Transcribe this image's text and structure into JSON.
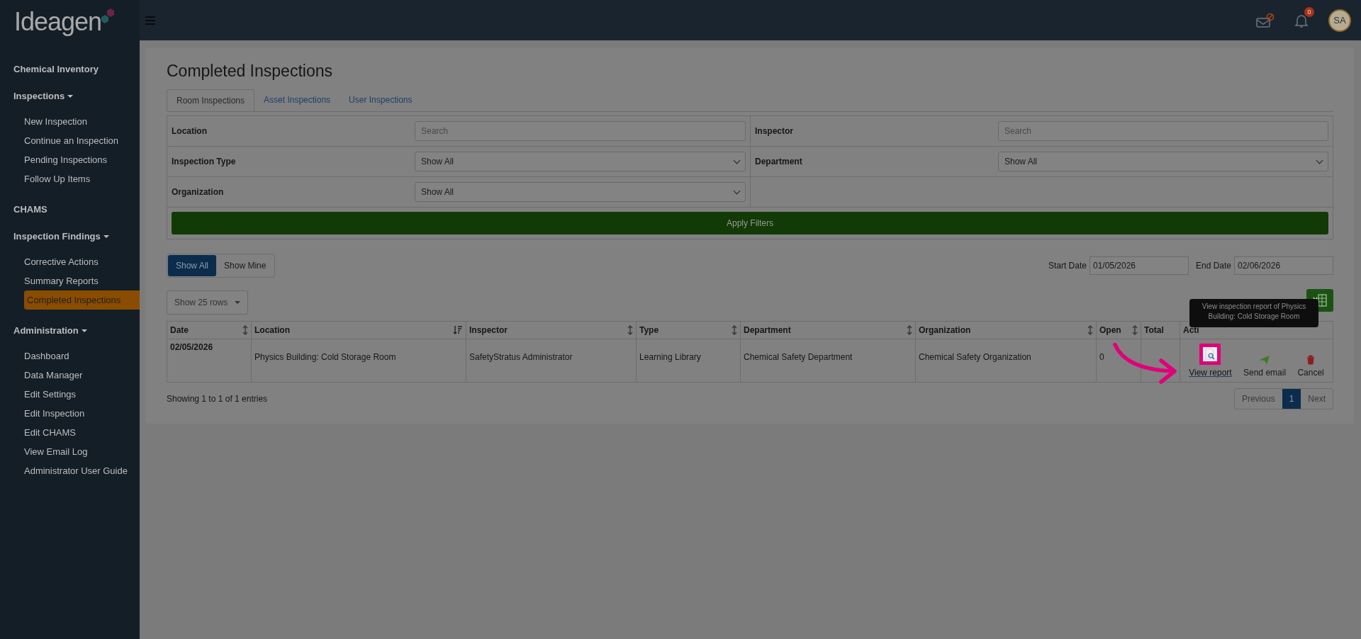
{
  "logo": {
    "text": "Ideagen"
  },
  "header": {
    "notification_count": "0",
    "avatar": "SA"
  },
  "sidebar": {
    "items": [
      {
        "label": "Chemical Inventory"
      },
      {
        "label": "Inspections",
        "expanded": true,
        "children": [
          {
            "label": "New Inspection",
            "selected": false
          },
          {
            "label": "Continue an Inspection",
            "selected": false
          },
          {
            "label": "Pending Inspections",
            "selected": false
          },
          {
            "label": "Follow Up Items",
            "selected": false
          }
        ]
      },
      {
        "label": "CHAMS"
      },
      {
        "label": "Inspection Findings",
        "expanded": true,
        "children": [
          {
            "label": "Corrective Actions",
            "selected": false
          },
          {
            "label": "Summary Reports",
            "selected": false
          },
          {
            "label": "Completed Inspections",
            "selected": true
          }
        ]
      },
      {
        "label": "Administration",
        "expanded": true,
        "children": [
          {
            "label": "Dashboard",
            "selected": false
          },
          {
            "label": "Data Manager",
            "selected": false
          },
          {
            "label": "Edit Settings",
            "selected": false
          },
          {
            "label": "Edit Inspection",
            "selected": false
          },
          {
            "label": "Edit CHAMS",
            "selected": false
          },
          {
            "label": "View Email Log",
            "selected": false
          },
          {
            "label": "Administrator User Guide",
            "selected": false
          }
        ]
      }
    ]
  },
  "page_title": "Completed Inspections",
  "tabs": [
    {
      "label": "Room Inspections",
      "selected": true
    },
    {
      "label": "Asset Inspections",
      "selected": false
    },
    {
      "label": "User Inspections",
      "selected": false
    }
  ],
  "filters": {
    "left": [
      {
        "label": "Location",
        "kind": "search",
        "placeholder": "Search"
      },
      {
        "label": "Inspection Type",
        "kind": "select",
        "value": "Show All"
      },
      {
        "label": "Organization",
        "kind": "select",
        "value": "Show All"
      }
    ],
    "right": [
      {
        "label": "Inspector",
        "kind": "search",
        "placeholder": "Search"
      },
      {
        "label": "Department",
        "kind": "select",
        "value": "Show All"
      }
    ]
  },
  "apply_button": "Apply Filters",
  "scope_toggle": [
    {
      "label": "Show All",
      "selected": true
    },
    {
      "label": "Show Mine",
      "selected": false
    }
  ],
  "date_range": {
    "start_label": "Start Date",
    "start": "01/05/2026",
    "end_label": "End Date",
    "end": "02/06/2026"
  },
  "rows_select": "Show 25 rows",
  "table": {
    "columns": [
      {
        "label": "Date",
        "sorted": false
      },
      {
        "label": "Location",
        "sorted": true
      },
      {
        "label": "Inspector",
        "sorted": false
      },
      {
        "label": "Type",
        "sorted": false
      },
      {
        "label": "Department",
        "sorted": false
      },
      {
        "label": "Organization",
        "sorted": false
      },
      {
        "label": "Open",
        "sorted": false
      },
      {
        "label": "Total"
      },
      {
        "label": "Acti"
      }
    ],
    "rows": [
      {
        "date": "02/05/2026",
        "location": "Physics Building: Cold Storage Room",
        "inspector": "SafetyStratus Administrator",
        "type": "Learning Library",
        "department": "Chemical Safety Department",
        "organization": "Chemical Safety Organization",
        "open": "0",
        "actions": [
          {
            "kind": "view",
            "label": "View report"
          },
          {
            "kind": "email",
            "label": "Send email"
          },
          {
            "kind": "cancel",
            "label": "Cancel"
          }
        ]
      }
    ]
  },
  "tooltip": "View inspection report of Physics Building: Cold Storage Room",
  "footer": {
    "info": "Showing 1 to 1 of 1 entries",
    "pages": [
      {
        "label": "Previous",
        "selected": false
      },
      {
        "label": "1",
        "selected": true
      },
      {
        "label": "Next",
        "selected": false
      }
    ]
  }
}
